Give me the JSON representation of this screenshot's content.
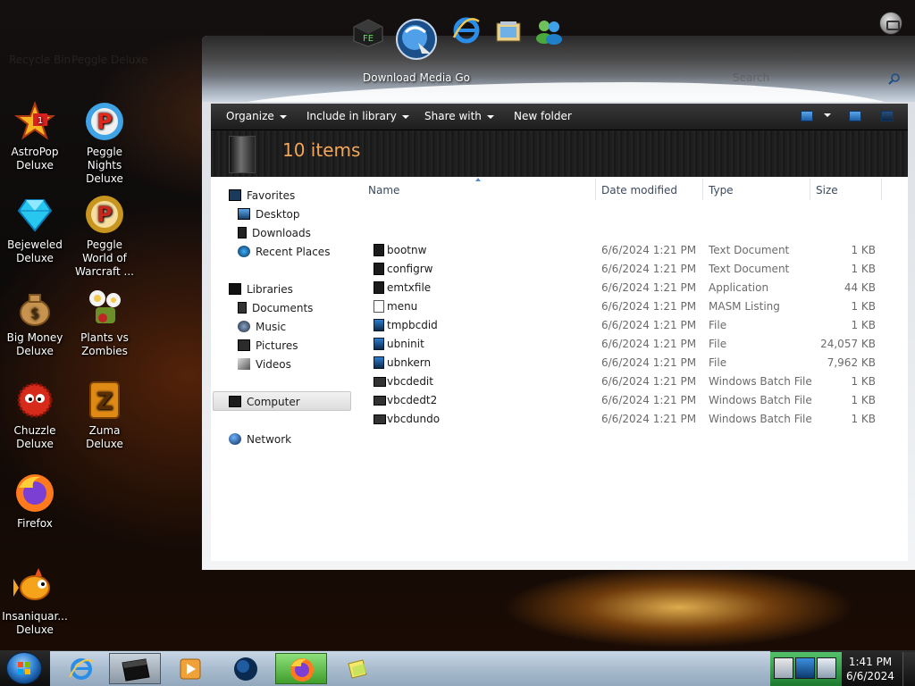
{
  "desktop": {
    "ghost_labels": [
      "Recycle Bin",
      "Peggle Deluxe"
    ],
    "icons": [
      {
        "label": "AstroPop Deluxe",
        "icon": "astropop-icon"
      },
      {
        "label": "Peggle Nights Deluxe",
        "icon": "peggle-nights-icon"
      },
      {
        "label": "Bejeweled Deluxe",
        "icon": "bejeweled-icon"
      },
      {
        "label": "Peggle World of Warcraft ...",
        "icon": "peggle-wow-icon"
      },
      {
        "label": "Big Money Deluxe",
        "icon": "money-bag-icon"
      },
      {
        "label": "Plants vs Zombies",
        "icon": "plants-zombies-icon"
      },
      {
        "label": "Chuzzle Deluxe",
        "icon": "chuzzle-icon"
      },
      {
        "label": "Zuma Deluxe",
        "icon": "zuma-icon"
      },
      {
        "label": "Firefox",
        "icon": "firefox-icon"
      },
      {
        "label": "Insaniquar... Deluxe",
        "icon": "insaniquarium-icon"
      }
    ]
  },
  "dock": {
    "label": "Download Media Go",
    "items": [
      "media-cube-icon",
      "download-media-go-icon",
      "internet-explorer-icon",
      "photo-viewer-icon",
      "messenger-icon"
    ]
  },
  "explorer": {
    "search_placeholder": "Search",
    "toolbar": {
      "organize": "Organize",
      "include_in_library": "Include in library",
      "share_with": "Share with",
      "new_folder": "New folder"
    },
    "item_count": "10 items",
    "nav": {
      "favorites": "Favorites",
      "desktop": "Desktop",
      "downloads": "Downloads",
      "recent_places": "Recent Places",
      "libraries": "Libraries",
      "documents": "Documents",
      "music": "Music",
      "pictures": "Pictures",
      "videos": "Videos",
      "computer": "Computer",
      "network": "Network"
    },
    "columns": {
      "name": "Name",
      "date": "Date modified",
      "type": "Type",
      "size": "Size"
    },
    "files": [
      {
        "name": "bootnw",
        "date": "6/6/2024 1:21 PM",
        "type": "Text Document",
        "size": "1 KB"
      },
      {
        "name": "configrw",
        "date": "6/6/2024 1:21 PM",
        "type": "Text Document",
        "size": "1 KB"
      },
      {
        "name": "emtxfile",
        "date": "6/6/2024 1:21 PM",
        "type": "Application",
        "size": "44 KB"
      },
      {
        "name": "menu",
        "date": "6/6/2024 1:21 PM",
        "type": "MASM Listing",
        "size": "1 KB"
      },
      {
        "name": "tmpbcdid",
        "date": "6/6/2024 1:21 PM",
        "type": "File",
        "size": "1 KB"
      },
      {
        "name": "ubninit",
        "date": "6/6/2024 1:21 PM",
        "type": "File",
        "size": "24,057 KB"
      },
      {
        "name": "ubnkern",
        "date": "6/6/2024 1:21 PM",
        "type": "File",
        "size": "7,962 KB"
      },
      {
        "name": "vbcdedit",
        "date": "6/6/2024 1:21 PM",
        "type": "Windows Batch File",
        "size": "1 KB"
      },
      {
        "name": "vbcdedt2",
        "date": "6/6/2024 1:21 PM",
        "type": "Windows Batch File",
        "size": "1 KB"
      },
      {
        "name": "vbcdundo",
        "date": "6/6/2024 1:21 PM",
        "type": "Windows Batch File",
        "size": "1 KB"
      }
    ]
  },
  "taskbar": {
    "time": "1:41 PM",
    "date": "6/6/2024",
    "tasks": [
      "internet-explorer-icon",
      "explorer-icon",
      "media-player-icon",
      "network-globe-icon",
      "firefox-icon",
      "sticky-notes-icon"
    ],
    "tray": [
      "network-tray-icon",
      "display-tray-icon",
      "volume-tray-icon"
    ]
  }
}
